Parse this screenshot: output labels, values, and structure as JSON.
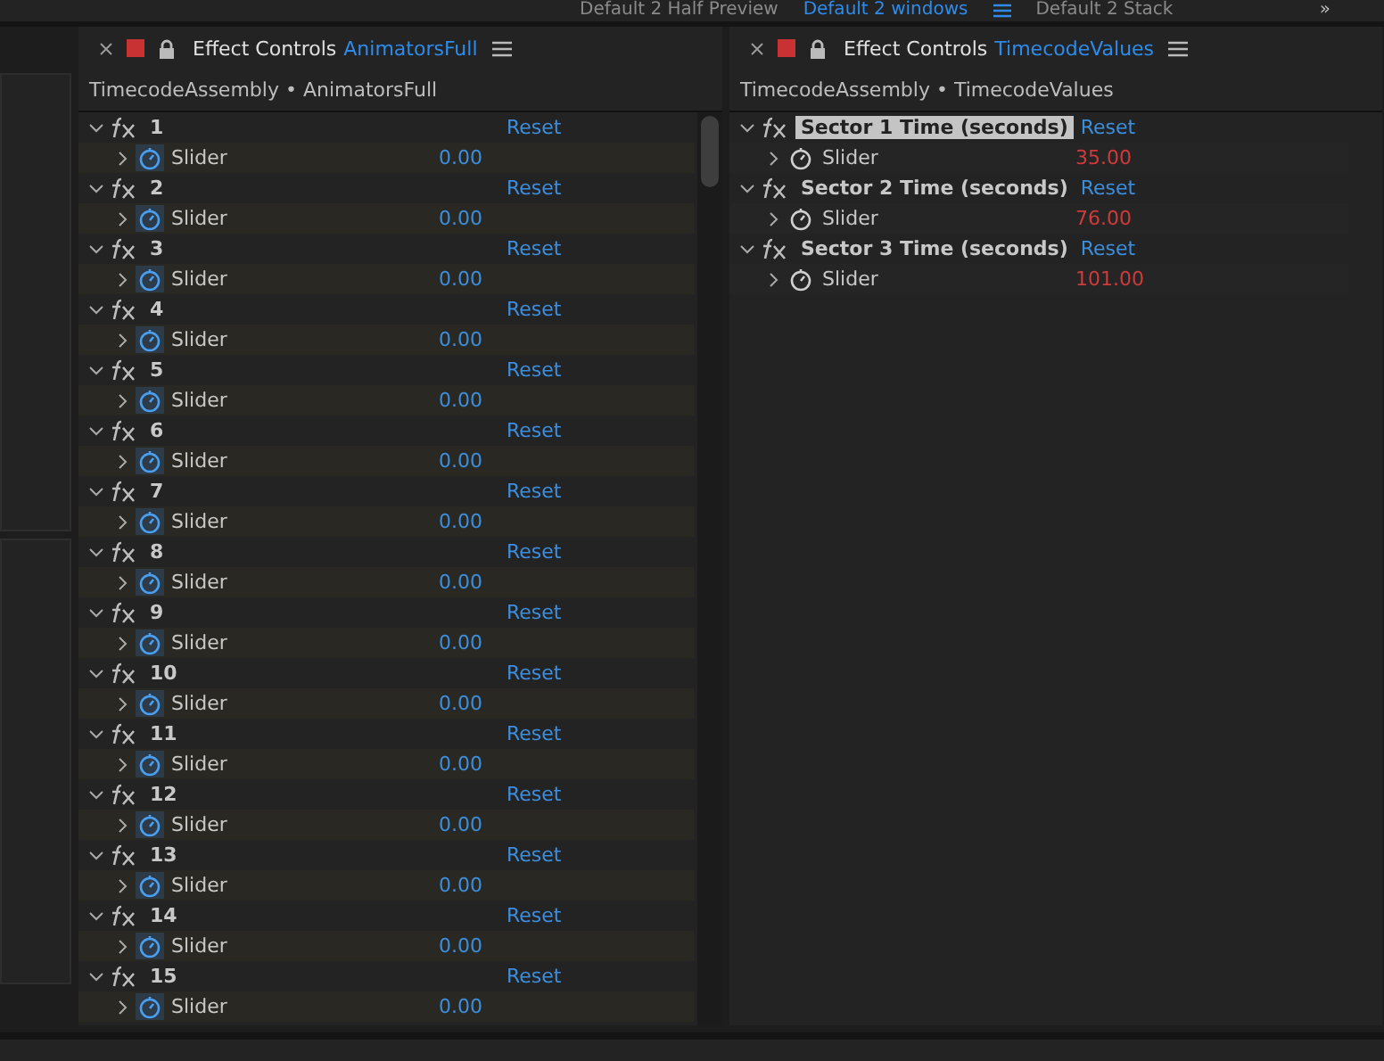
{
  "workspace_bar": {
    "items": [
      {
        "label": "Default 2 Half Preview",
        "selected": false
      },
      {
        "label": "Default 2 windows",
        "selected": true
      },
      {
        "label": "Default 2 Stack",
        "selected": false
      }
    ],
    "overflow": "»"
  },
  "panels": [
    {
      "title": "Effect Controls",
      "layer": "AnimatorsFull",
      "breadcrumb": "TimecodeAssembly • AnimatorsFull",
      "effects": [
        {
          "name": "1",
          "selected": false,
          "reset": "Reset",
          "param": "Slider",
          "value": "0.00",
          "stopwatch_on": true,
          "expression": false
        },
        {
          "name": "2",
          "selected": false,
          "reset": "Reset",
          "param": "Slider",
          "value": "0.00",
          "stopwatch_on": true,
          "expression": false
        },
        {
          "name": "3",
          "selected": false,
          "reset": "Reset",
          "param": "Slider",
          "value": "0.00",
          "stopwatch_on": true,
          "expression": false
        },
        {
          "name": "4",
          "selected": false,
          "reset": "Reset",
          "param": "Slider",
          "value": "0.00",
          "stopwatch_on": true,
          "expression": false
        },
        {
          "name": "5",
          "selected": false,
          "reset": "Reset",
          "param": "Slider",
          "value": "0.00",
          "stopwatch_on": true,
          "expression": false
        },
        {
          "name": "6",
          "selected": false,
          "reset": "Reset",
          "param": "Slider",
          "value": "0.00",
          "stopwatch_on": true,
          "expression": false
        },
        {
          "name": "7",
          "selected": false,
          "reset": "Reset",
          "param": "Slider",
          "value": "0.00",
          "stopwatch_on": true,
          "expression": false
        },
        {
          "name": "8",
          "selected": false,
          "reset": "Reset",
          "param": "Slider",
          "value": "0.00",
          "stopwatch_on": true,
          "expression": false
        },
        {
          "name": "9",
          "selected": false,
          "reset": "Reset",
          "param": "Slider",
          "value": "0.00",
          "stopwatch_on": true,
          "expression": false
        },
        {
          "name": "10",
          "selected": false,
          "reset": "Reset",
          "param": "Slider",
          "value": "0.00",
          "stopwatch_on": true,
          "expression": false
        },
        {
          "name": "11",
          "selected": false,
          "reset": "Reset",
          "param": "Slider",
          "value": "0.00",
          "stopwatch_on": true,
          "expression": false
        },
        {
          "name": "12",
          "selected": false,
          "reset": "Reset",
          "param": "Slider",
          "value": "0.00",
          "stopwatch_on": true,
          "expression": false
        },
        {
          "name": "13",
          "selected": false,
          "reset": "Reset",
          "param": "Slider",
          "value": "0.00",
          "stopwatch_on": true,
          "expression": false
        },
        {
          "name": "14",
          "selected": false,
          "reset": "Reset",
          "param": "Slider",
          "value": "0.00",
          "stopwatch_on": true,
          "expression": false
        },
        {
          "name": "15",
          "selected": false,
          "reset": "Reset",
          "param": "Slider",
          "value": "0.00",
          "stopwatch_on": true,
          "expression": false
        }
      ]
    },
    {
      "title": "Effect Controls",
      "layer": "TimecodeValues",
      "breadcrumb": "TimecodeAssembly • TimecodeValues",
      "effects": [
        {
          "name": "Sector 1 Time (seconds)",
          "selected": true,
          "reset": "Reset",
          "param": "Slider",
          "value": "35.00",
          "stopwatch_on": false,
          "expression": true
        },
        {
          "name": "Sector 2 Time (seconds)",
          "selected": false,
          "reset": "Reset",
          "param": "Slider",
          "value": "76.00",
          "stopwatch_on": false,
          "expression": true
        },
        {
          "name": "Sector 3 Time (seconds)",
          "selected": false,
          "reset": "Reset",
          "param": "Slider",
          "value": "101.00",
          "stopwatch_on": false,
          "expression": true
        }
      ]
    }
  ]
}
